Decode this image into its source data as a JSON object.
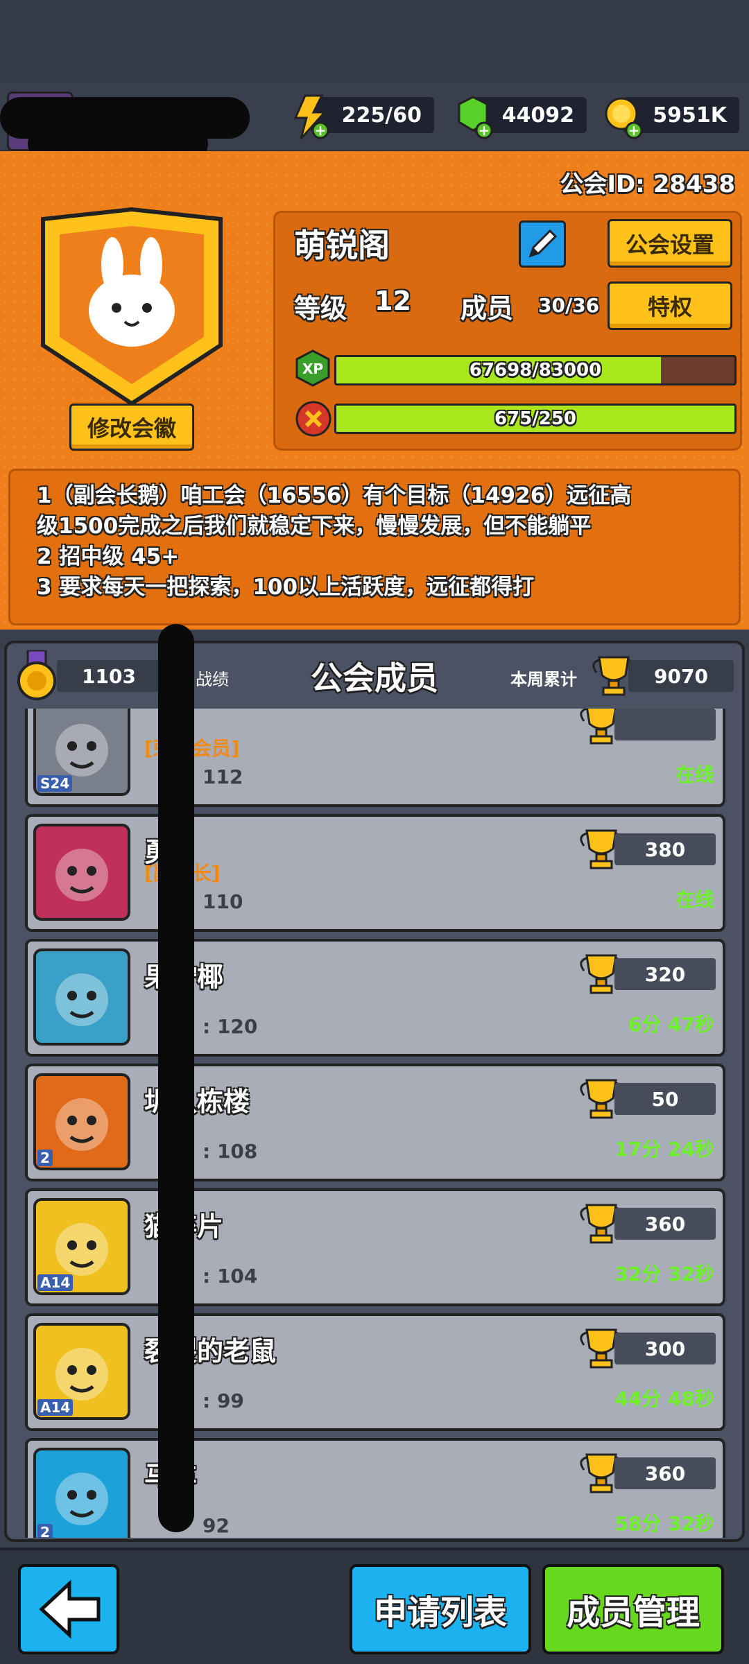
{
  "resources": {
    "energy": "225/60",
    "gems": "44092",
    "coins": "5951K"
  },
  "guild": {
    "id_label": "公会ID: 28438",
    "name": "萌锐阁",
    "level_label": "等级",
    "level_value": "12",
    "members_label": "成员",
    "members_value": "30/36",
    "settings_button": "公会设置",
    "privilege_button": "特权",
    "change_badge_button": "修改会徽",
    "xp_label": "XP",
    "xp_text": "67698/83000",
    "xp_fraction": 0.8156,
    "activity_text": "675/250",
    "activity_fraction": 1.0
  },
  "notice": {
    "lines": [
      "1（副会长鹅）咱工会（16556）有个目标（14926）远征高",
      "级1500完成之后我们就稳定下来，慢慢发展，但不能躺平",
      "2 招中级 45+",
      "3 要求每天一把探索，100以上活跃度，远征都得打"
    ]
  },
  "members_panel": {
    "medal_value": "1103",
    "record_label": "战绩",
    "title": "公会成员",
    "weekly_label": "本周累计",
    "weekly_value": "9070"
  },
  "members": [
    {
      "name": "",
      "role": "[荣誉会员]",
      "level": "112",
      "trophies": "",
      "status": "在线",
      "tag": "S24"
    },
    {
      "name": "勇",
      "role": "[副会长]",
      "level": "110",
      "trophies": "380",
      "status": "在线",
      "tag": ""
    },
    {
      "name": "果柠椰",
      "role": "",
      "level": ": 120",
      "trophies": "320",
      "status": "6分 47秒",
      "tag": ""
    },
    {
      "name": "圳八栋楼",
      "role": "",
      "level": ": 108",
      "trophies": "50",
      "status": "17分 24秒",
      "tag": "2"
    },
    {
      "name": "猫碎片",
      "role": "",
      "level": ": 104",
      "trophies": "360",
      "status": "32分 32秒",
      "tag": "A14"
    },
    {
      "name": "裂裂的老鼠",
      "role": "",
      "level": ": 99",
      "trophies": "300",
      "status": "44分 48秒",
      "tag": "A14"
    },
    {
      "name": "马车",
      "role": "",
      "level": "92",
      "trophies": "360",
      "status": "58分 32秒",
      "tag": "2"
    }
  ],
  "bottom": {
    "apply_list": "申请列表",
    "member_manage": "成员管理"
  },
  "colors": {
    "orange": "#ef7f1a",
    "green_bar": "#a8e81c",
    "online": "#6ef02a",
    "gold": "#ffc21a"
  }
}
